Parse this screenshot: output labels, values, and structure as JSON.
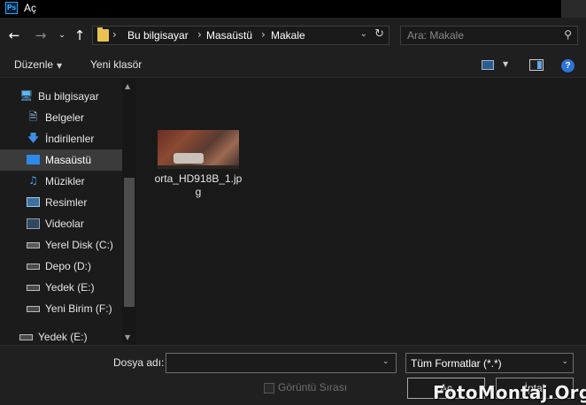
{
  "window": {
    "title": "Aç",
    "app_icon_text": "Ps"
  },
  "nav": {
    "back_icon": "arrow-left-icon",
    "forward_icon": "arrow-right-icon",
    "recent_icon": "chevron-down-icon",
    "up_icon": "arrow-up-icon",
    "breadcrumb": [
      "Bu bilgisayar",
      "Masaüstü",
      "Makale"
    ],
    "search_placeholder": "Ara: Makale"
  },
  "toolbar": {
    "organize_label": "Düzenle",
    "new_folder_label": "Yeni klasör",
    "help_label": "?"
  },
  "sidebar": {
    "items": [
      {
        "label": "Bu bilgisayar",
        "icon": "computer-icon"
      },
      {
        "label": "Belgeler",
        "icon": "document-icon"
      },
      {
        "label": "İndirilenler",
        "icon": "download-icon"
      },
      {
        "label": "Masaüstü",
        "icon": "desktop-icon",
        "selected": true
      },
      {
        "label": "Müzikler",
        "icon": "music-icon"
      },
      {
        "label": "Resimler",
        "icon": "pictures-icon"
      },
      {
        "label": "Videolar",
        "icon": "videos-icon"
      },
      {
        "label": "Yerel Disk (C:)",
        "icon": "drive-c-icon"
      },
      {
        "label": "Depo (D:)",
        "icon": "drive-icon"
      },
      {
        "label": "Yedek (E:)",
        "icon": "drive-icon"
      },
      {
        "label": "Yeni Birim (F:)",
        "icon": "drive-icon"
      },
      {
        "label": "Yedek (E:)",
        "icon": "drive-icon"
      }
    ]
  },
  "files": [
    {
      "name": "orta_HD918B_1.jpg",
      "type": "image-thumbnail"
    }
  ],
  "bottom": {
    "filename_label": "Dosya adı:",
    "filename_value": "",
    "filter_value": "Tüm Formatlar (*.*)",
    "image_sequence_label": "Görüntü Sırası",
    "open_label": "Aç",
    "cancel_label": "İptal"
  },
  "watermark": "FotoMontaj.Org",
  "colors": {
    "background": "#1b1b1b",
    "selection": "#3b3b3b",
    "folder": "#e8c352",
    "accent_blue": "#2e74d6"
  }
}
